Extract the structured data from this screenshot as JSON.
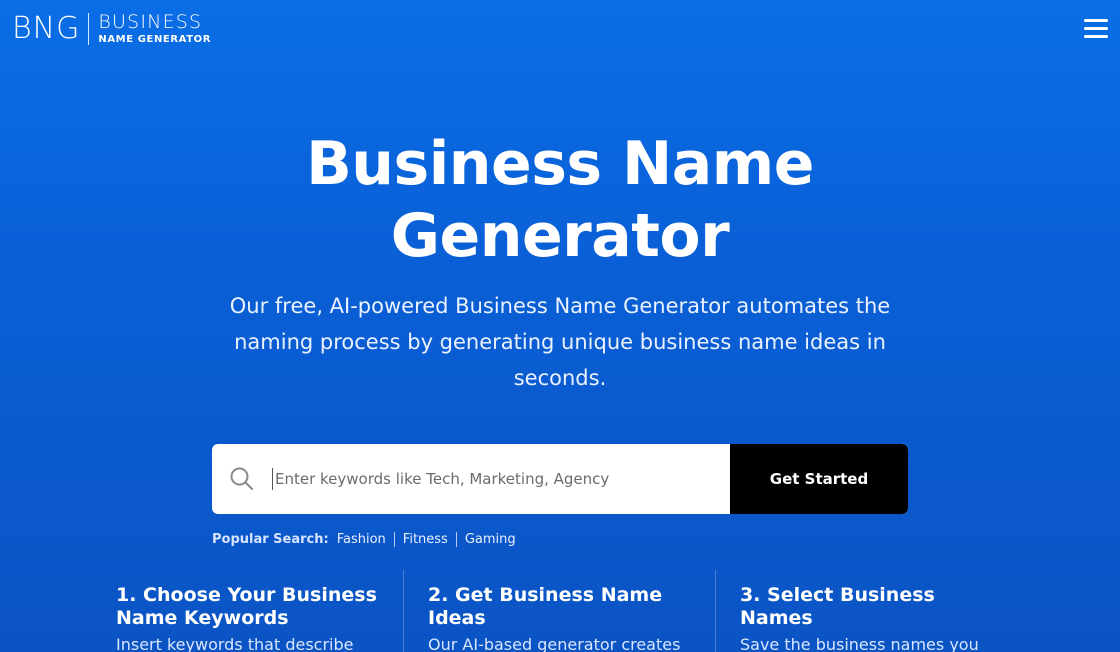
{
  "header": {
    "logo_mark": "BNG",
    "logo_title": "BUSINESS",
    "logo_subtitle": "NAME GENERATOR",
    "menu_icon": "hamburger-icon"
  },
  "hero": {
    "title_line1": "Business Name",
    "title_line2": "Generator",
    "description": "Our free, AI-powered Business Name Generator automates the naming process by generating unique business name ideas in seconds."
  },
  "search": {
    "icon": "search-icon",
    "placeholder": "Enter keywords like Tech, Marketing, Agency",
    "button_label": "Get Started"
  },
  "popular": {
    "label": "Popular Search:",
    "items": [
      "Fashion",
      "Fitness",
      "Gaming"
    ]
  },
  "steps": [
    {
      "title": "1. Choose Your Business Name Keywords",
      "text": "Insert keywords that describe"
    },
    {
      "title": "2. Get Business Name Ideas",
      "text": "Our AI-based generator creates"
    },
    {
      "title": "3. Select Business Names",
      "text": "Save the business names you like, see domain availability, and"
    }
  ],
  "colors": {
    "background_top": "#0a6ee6",
    "background_bottom": "#0b54c4",
    "button": "#000000"
  }
}
